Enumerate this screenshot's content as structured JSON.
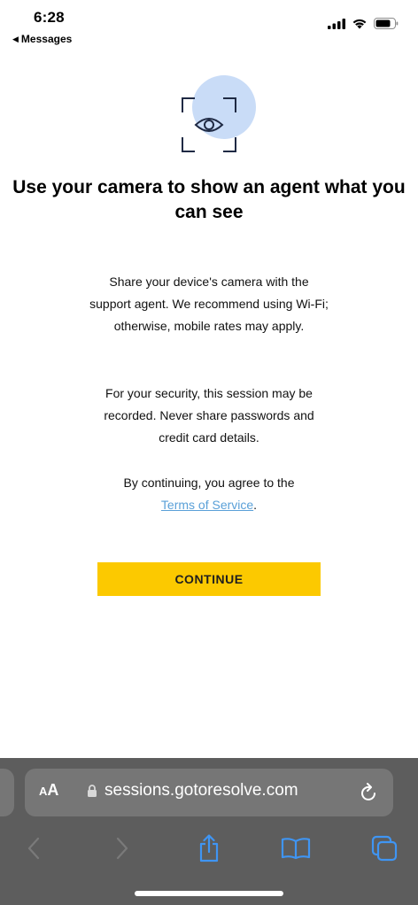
{
  "status_bar": {
    "time": "6:28",
    "back_app": "Messages",
    "icons": [
      "cellular-signal-icon",
      "wifi-icon",
      "battery-icon"
    ]
  },
  "hero": {
    "icon": "camera-eye-icon"
  },
  "main": {
    "title": "Use your camera to show an agent what you can see",
    "paragraph_1": "Share your device's camera with the support agent. We recommend using Wi-Fi; otherwise, mobile rates may apply.",
    "paragraph_2": "For your security, this session may be recorded. Never share passwords and credit card details.",
    "paragraph_3_prefix": "By continuing, you agree to the",
    "terms_link": "Terms of Service",
    "paragraph_3_suffix": ".",
    "continue_label": "CONTINUE"
  },
  "browser": {
    "aa_small": "A",
    "aa_large": "A",
    "url": "sessions.gotoresolve.com",
    "toolbar_icons": [
      "back-icon",
      "forward-icon",
      "share-icon",
      "bookmarks-icon",
      "tabs-icon"
    ]
  },
  "colors": {
    "accent_yellow": "#fcc900",
    "link_blue": "#5aa0d8",
    "hero_circle": "#c9dcf7",
    "toolbar_gray": "#5d5d5d",
    "toolbar_icon_blue": "#3f95f3"
  }
}
